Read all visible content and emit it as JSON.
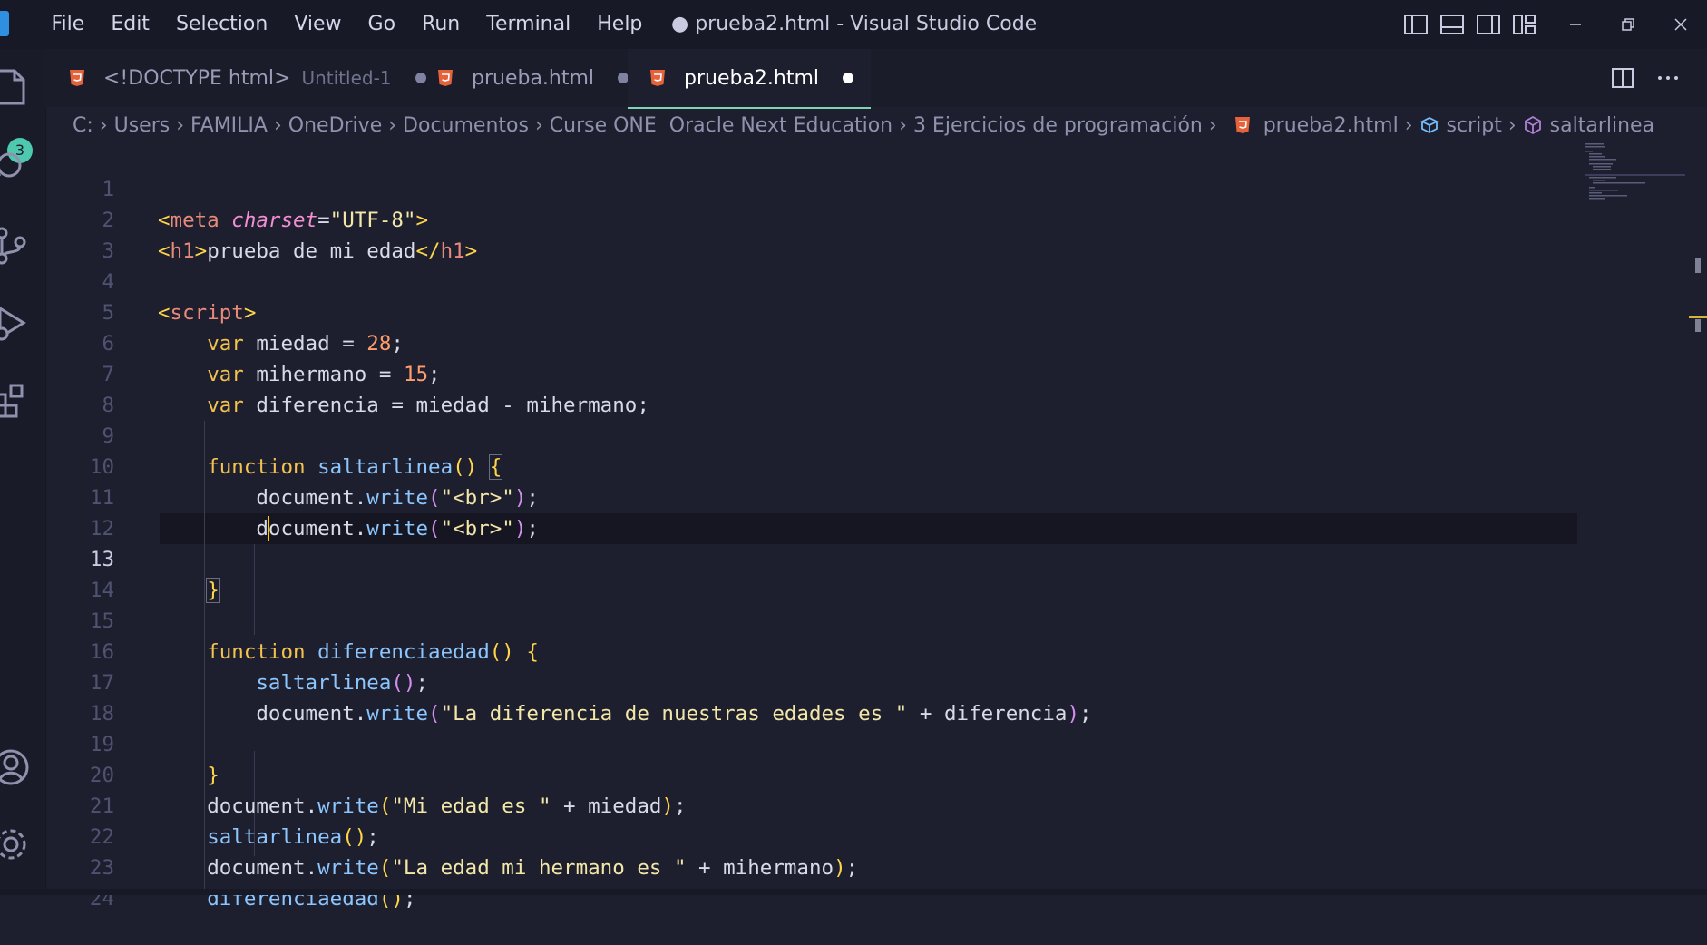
{
  "menu": {
    "items": [
      "File",
      "Edit",
      "Selection",
      "View",
      "Go",
      "Run",
      "Terminal",
      "Help"
    ]
  },
  "window": {
    "title": "● prueba2.html - Visual Studio Code"
  },
  "activity": {
    "badge": "3"
  },
  "tabs": [
    {
      "name": "<!DOCTYPE html>",
      "sub": "Untitled-1"
    },
    {
      "name": "prueba.html"
    },
    {
      "name": "prueba2.html"
    }
  ],
  "breadcrumb": {
    "items": [
      "C:",
      "Users",
      "FAMILIA",
      "OneDrive",
      "Documentos",
      "Curse ONE  Oracle Next Education",
      "3 Ejercicios de programación",
      "prueba2.html",
      "script",
      "saltarlinea"
    ]
  },
  "editor": {
    "line_numbers": [
      "1",
      "2",
      "3",
      "4",
      "5",
      "6",
      "7",
      "8",
      "9",
      "10",
      "11",
      "12",
      "13",
      "14",
      "15",
      "16",
      "17",
      "18",
      "19",
      "20",
      "21",
      "22",
      "23",
      "24"
    ],
    "current_line": "13",
    "t": {
      "lt": "<",
      "gt": ">",
      "ltslash": "</",
      "meta": "meta",
      "charset": "charset",
      "eq": "=",
      "utf8": "\"UTF-8\"",
      "h1": "h1",
      "h1text": "prueba de mi edad",
      "script": "script",
      "var": "var",
      "miedad": "miedad",
      "assign": " = ",
      "n28": "28",
      "semi": ";",
      "mihermano": "mihermano",
      "n15": "15",
      "diferencia": "diferencia",
      "minus": " - ",
      "function": "function",
      "saltarlinea": "saltarlinea",
      "parens": "()",
      "lbrace": "{",
      "rbrace": "}",
      "document": "document",
      "dot": ".",
      "write": "write",
      "lparen": "(",
      "rparen": ")",
      "brstr": "\"<br>\"",
      "diferenciaedad": "diferenciaedad",
      "str_dif": "\"La diferencia de nuestras edades es \"",
      "plus": " + ",
      "str_mi": "\"Mi edad es \"",
      "str_herm": "\"La edad mi hermano es \""
    }
  },
  "colors": {
    "background": "#1e1f2e",
    "tab_active_underline": "#7fd4b3",
    "keyword": "#f4c24f",
    "function": "#8bc6ff",
    "tag": "#e88a7b",
    "string": "#f2e7a8",
    "number": "#ff9d6d"
  },
  "icons": [
    "vscode-logo",
    "explorer-icon",
    "search-icon",
    "source-control-icon",
    "run-debug-icon",
    "extensions-icon",
    "account-icon",
    "settings-gear-icon",
    "html5-icon",
    "split-editor-icon",
    "more-actions-icon",
    "symbol-class-icon",
    "symbol-method-icon",
    "layout-sidebar-left-icon",
    "layout-panel-icon",
    "layout-sidebar-right-icon",
    "customize-layout-icon"
  ]
}
